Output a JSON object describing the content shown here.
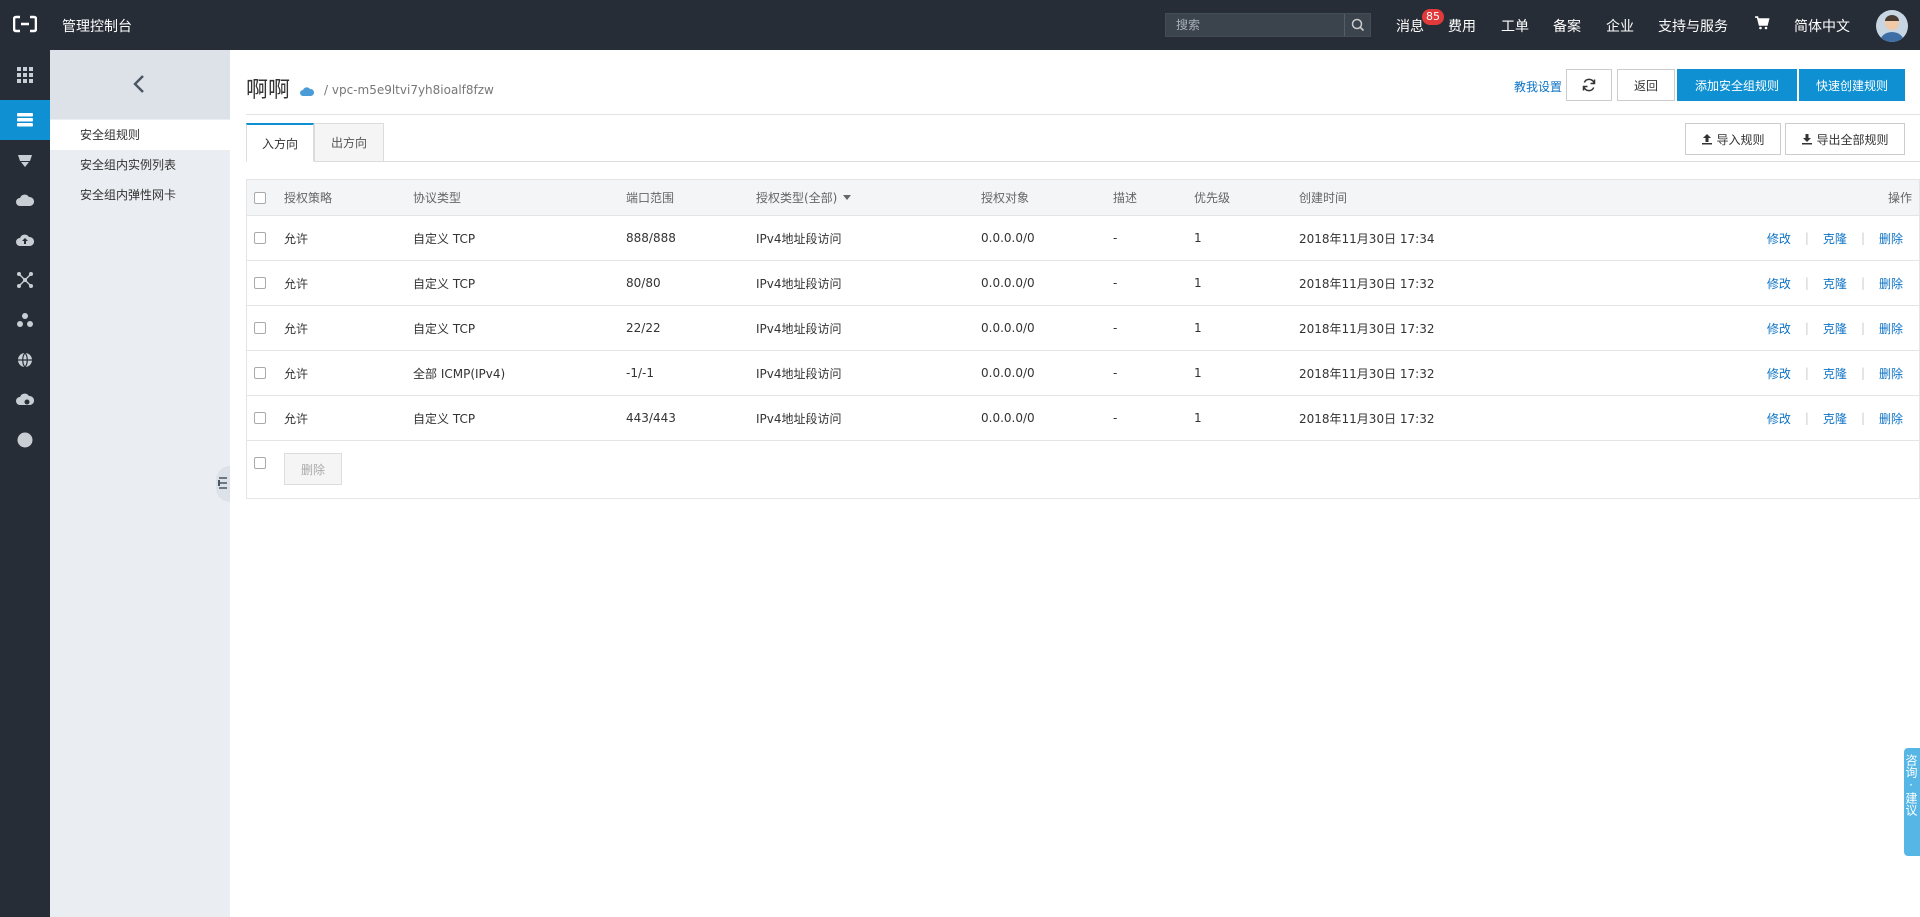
{
  "topbar": {
    "console_title": "管理控制台",
    "search_placeholder": "搜索",
    "nav": {
      "messages": "消息",
      "messages_count": "85",
      "billing": "费用",
      "tickets": "工单",
      "icp": "备案",
      "enterprise": "企业",
      "support": "支持与服务",
      "language": "简体中文"
    }
  },
  "sidebar": {
    "items": [
      {
        "label": "安全组规则"
      },
      {
        "label": "安全组内实例列表"
      },
      {
        "label": "安全组内弹性网卡"
      }
    ]
  },
  "header": {
    "title": "啊啊",
    "vpc_path": "/ vpc-m5e9ltvi7yh8ioalf8fzw",
    "help_link": "教我设置",
    "back_button": "返回",
    "add_rule_button": "添加安全组规则",
    "quick_create_button": "快速创建规则"
  },
  "tabs": {
    "inbound": "入方向",
    "outbound": "出方向"
  },
  "actions": {
    "import_rules": "导入规则",
    "export_all_rules": "导出全部规则"
  },
  "table": {
    "columns": {
      "policy": "授权策略",
      "protocol": "协议类型",
      "port_range": "端口范围",
      "auth_type": "授权类型(全部)",
      "auth_object": "授权对象",
      "description": "描述",
      "priority": "优先级",
      "created": "创建时间",
      "operations": "操作"
    },
    "rows": [
      {
        "policy": "允许",
        "protocol": "自定义 TCP",
        "port_range": "888/888",
        "auth_type": "IPv4地址段访问",
        "auth_object": "0.0.0.0/0",
        "description": "-",
        "priority": "1",
        "created": "2018年11月30日 17:34"
      },
      {
        "policy": "允许",
        "protocol": "自定义 TCP",
        "port_range": "80/80",
        "auth_type": "IPv4地址段访问",
        "auth_object": "0.0.0.0/0",
        "description": "-",
        "priority": "1",
        "created": "2018年11月30日 17:32"
      },
      {
        "policy": "允许",
        "protocol": "自定义 TCP",
        "port_range": "22/22",
        "auth_type": "IPv4地址段访问",
        "auth_object": "0.0.0.0/0",
        "description": "-",
        "priority": "1",
        "created": "2018年11月30日 17:32"
      },
      {
        "policy": "允许",
        "protocol": "全部 ICMP(IPv4)",
        "port_range": "-1/-1",
        "auth_type": "IPv4地址段访问",
        "auth_object": "0.0.0.0/0",
        "description": "-",
        "priority": "1",
        "created": "2018年11月30日 17:32"
      },
      {
        "policy": "允许",
        "protocol": "自定义 TCP",
        "port_range": "443/443",
        "auth_type": "IPv4地址段访问",
        "auth_object": "0.0.0.0/0",
        "description": "-",
        "priority": "1",
        "created": "2018年11月30日 17:32"
      }
    ],
    "row_ops": {
      "edit": "修改",
      "clone": "克隆",
      "delete": "删除"
    },
    "footer_delete": "删除"
  },
  "feedback": "咨询·建议",
  "colors": {
    "topbar_bg": "#262d36",
    "accent": "#0e90d2",
    "link": "#0e73c6",
    "badge": "#e23a3a"
  }
}
